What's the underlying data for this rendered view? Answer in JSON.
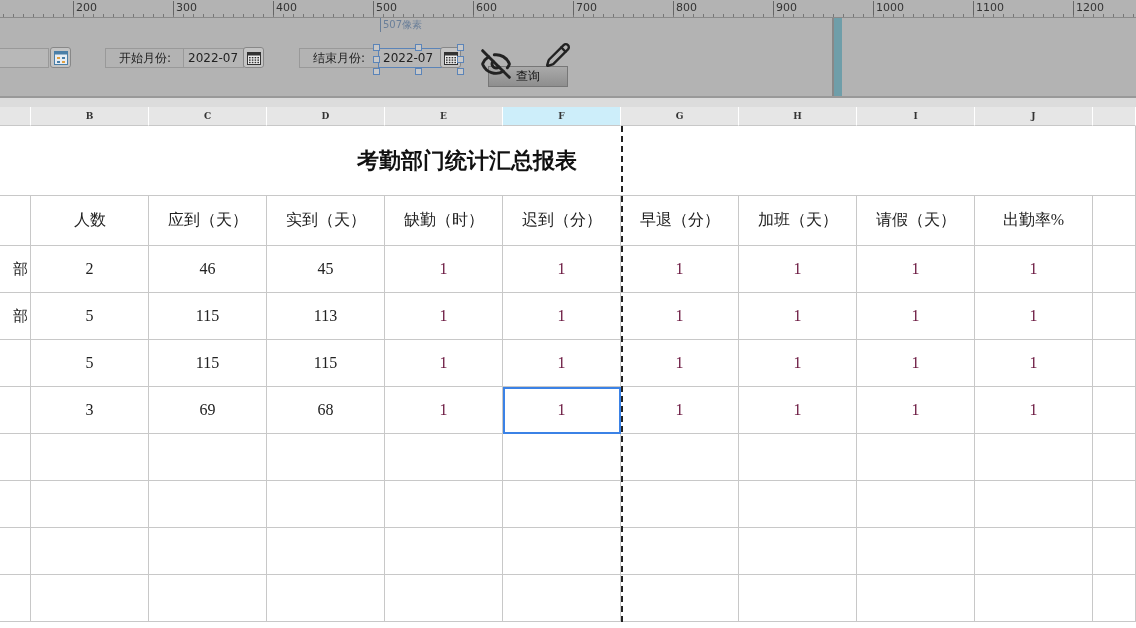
{
  "ruler": {
    "labels": [
      "200",
      "300",
      "400",
      "500",
      "600",
      "700",
      "800",
      "900",
      "1000",
      "1100",
      "1200"
    ],
    "marker": "507像素"
  },
  "form": {
    "fields": [
      {
        "label": "开始月份:",
        "value": "2022-07",
        "selected": false
      },
      {
        "label": "结束月份:",
        "value": "2022-07",
        "selected": true
      }
    ],
    "query_button": "查询"
  },
  "sheet": {
    "columns": [
      {
        "label": "B",
        "selected": false
      },
      {
        "label": "C",
        "selected": false
      },
      {
        "label": "D",
        "selected": false
      },
      {
        "label": "E",
        "selected": false
      },
      {
        "label": "F",
        "selected": true
      },
      {
        "label": "G",
        "selected": false
      },
      {
        "label": "H",
        "selected": false
      },
      {
        "label": "I",
        "selected": false
      },
      {
        "label": "J",
        "selected": false
      }
    ],
    "title": "考勤部门统计汇总报表",
    "headers": [
      "人数",
      "应到（天）",
      "实到（天）",
      "缺勤（时）",
      "迟到（分）",
      "早退（分）",
      "加班（天）",
      "请假（天）",
      "出勤率%"
    ],
    "rows": [
      {
        "dept": "部",
        "cells": [
          {
            "text": "2",
            "selected": false
          },
          {
            "text": "46",
            "selected": false
          },
          {
            "text": "45",
            "selected": false
          },
          {
            "text": "1",
            "selected": false
          },
          {
            "text": "1",
            "selected": false
          },
          {
            "text": "1",
            "selected": false
          },
          {
            "text": "1",
            "selected": false
          },
          {
            "text": "1",
            "selected": false
          },
          {
            "text": "1",
            "selected": false
          }
        ]
      },
      {
        "dept": "部",
        "cells": [
          {
            "text": "5",
            "selected": false
          },
          {
            "text": "115",
            "selected": false
          },
          {
            "text": "113",
            "selected": false
          },
          {
            "text": "1",
            "selected": false
          },
          {
            "text": "1",
            "selected": false
          },
          {
            "text": "1",
            "selected": false
          },
          {
            "text": "1",
            "selected": false
          },
          {
            "text": "1",
            "selected": false
          },
          {
            "text": "1",
            "selected": false
          }
        ]
      },
      {
        "cells": [
          {
            "text": "5",
            "selected": false
          },
          {
            "text": "115",
            "selected": false
          },
          {
            "text": "115",
            "selected": false
          },
          {
            "text": "1",
            "selected": false
          },
          {
            "text": "1",
            "selected": false
          },
          {
            "text": "1",
            "selected": false
          },
          {
            "text": "1",
            "selected": false
          },
          {
            "text": "1",
            "selected": false
          },
          {
            "text": "1",
            "selected": false
          }
        ]
      },
      {
        "cells": [
          {
            "text": "3",
            "selected": false
          },
          {
            "text": "69",
            "selected": false
          },
          {
            "text": "68",
            "selected": false
          },
          {
            "text": "1",
            "selected": false
          },
          {
            "text": "1",
            "selected": true
          },
          {
            "text": "1",
            "selected": false
          },
          {
            "text": "1",
            "selected": false
          },
          {
            "text": "1",
            "selected": false
          },
          {
            "text": "1",
            "selected": false
          }
        ]
      }
    ]
  }
}
